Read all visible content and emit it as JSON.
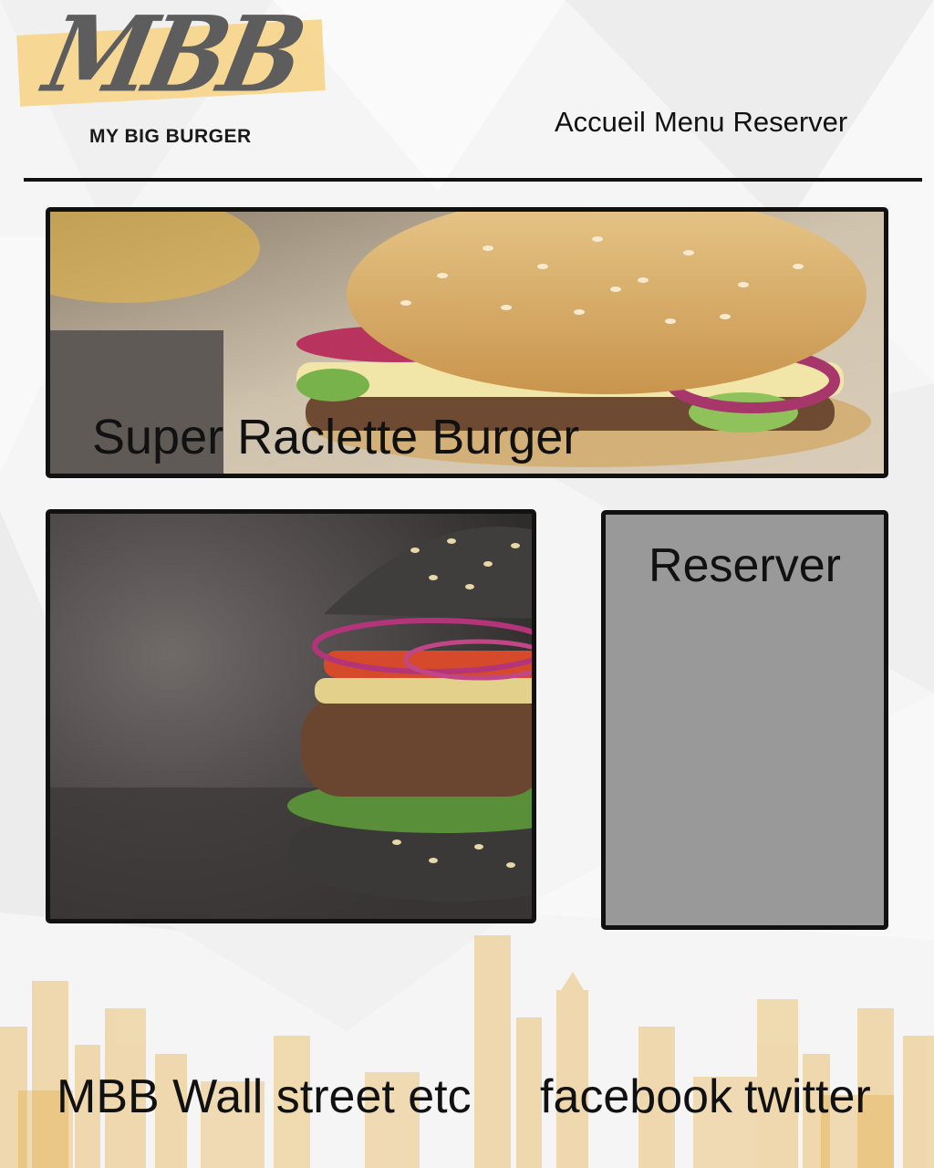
{
  "brand": {
    "mark": "MBB",
    "name": "MY BIG BURGER"
  },
  "nav": {
    "items": [
      "Accueil",
      "Menu",
      "Reserver"
    ]
  },
  "hero": {
    "title": "Super Raclette Burger"
  },
  "reserve": {
    "label": "Reserver"
  },
  "footer": {
    "left_text": "MBB Wall street etc",
    "social": [
      "facebook",
      "twitter"
    ]
  },
  "colors": {
    "accent": "#f6d48a",
    "skyline": "#e9b75c",
    "panel_gray": "#999999",
    "border": "#111111"
  }
}
